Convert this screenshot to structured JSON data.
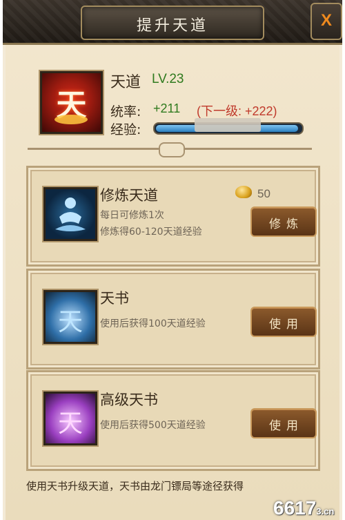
{
  "window": {
    "title": "提升天道",
    "close_label": "X"
  },
  "header": {
    "icon_glyph": "天",
    "name": "天道",
    "level": "LV.23",
    "stat_label": "统率:",
    "stat_value": "+211",
    "stat_next": "(下一级: +222)",
    "exp_label": "经验:",
    "exp_text": "",
    "exp_progress": 0.98
  },
  "cards": [
    {
      "title": "修炼天道",
      "desc1": "每日可修炼1次",
      "desc2": "修炼得60-120天道经验",
      "cost": "50",
      "button": "修炼"
    },
    {
      "icon_glyph": "天",
      "title": "天书",
      "desc1": "使用后获得100天道经验",
      "button": "使用"
    },
    {
      "icon_glyph": "天",
      "title": "高级天书",
      "desc1": "使用后获得500天道经验",
      "button": "使用"
    }
  ],
  "footer": {
    "text": "使用天书升级天道，天书由龙门镖局等途径获得"
  },
  "watermark": {
    "text": "6617",
    "suffix": "3.cn"
  }
}
